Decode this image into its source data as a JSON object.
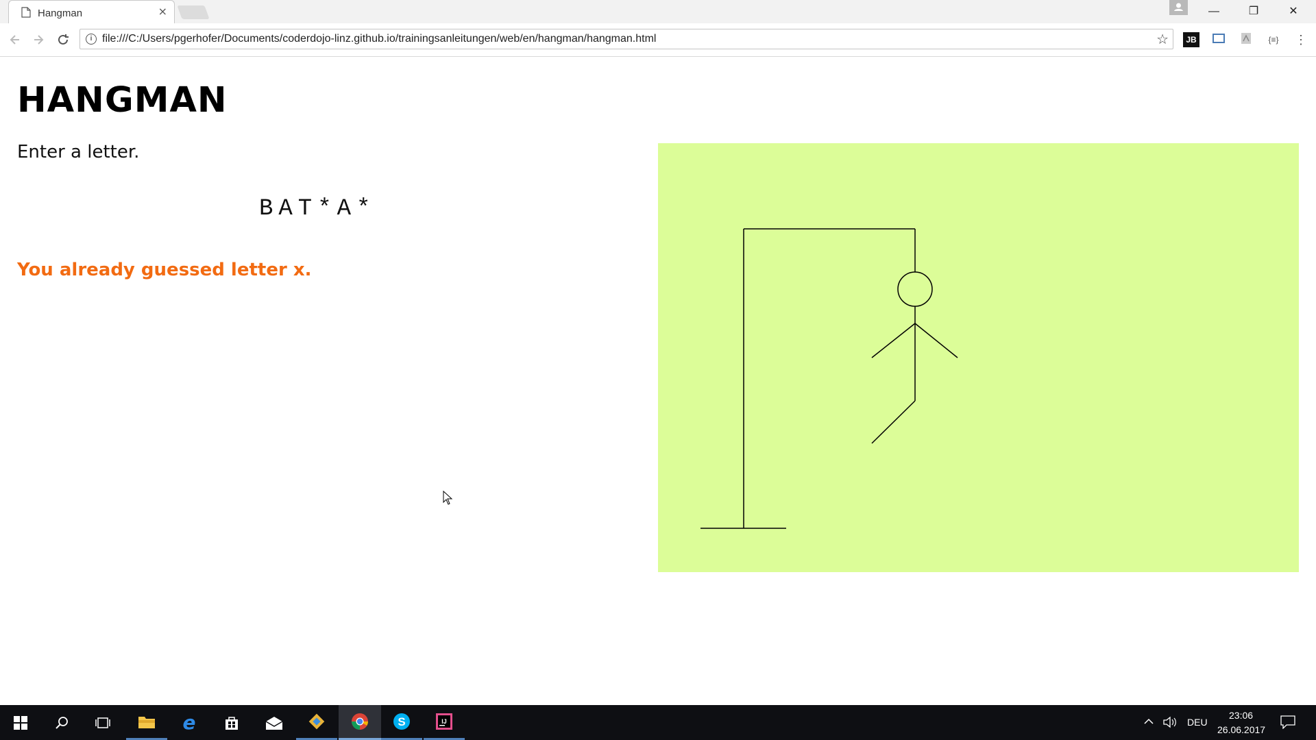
{
  "browser": {
    "tab_title": "Hangman",
    "tab_close": "×",
    "url": "file:///C:/Users/pgerhofer/Documents/coderdojo-linz.github.io/trainingsanleitungen/web/en/hangman/hangman.html",
    "window_controls": {
      "minimize": "—",
      "restore": "❐",
      "close": "✕"
    },
    "extensions": [
      "JB",
      "screen-capture-icon",
      "pdf-icon",
      "json-icon"
    ]
  },
  "page": {
    "heading": "HANGMAN",
    "prompt": "Enter a letter.",
    "word_display": "BAT*A*",
    "message": "You already guessed letter x.",
    "colors": {
      "message": "#f26b12",
      "board_background": "#dcfd98"
    },
    "hangman_parts_visible": [
      "base",
      "pole",
      "beam",
      "rope",
      "head",
      "body",
      "left-arm",
      "right-arm",
      "left-leg"
    ]
  },
  "taskbar": {
    "apps": [
      "start-icon",
      "search-icon",
      "task-view-icon",
      "file-explorer-icon",
      "edge-icon",
      "store-icon",
      "mail-icon",
      "git-icon",
      "chrome-icon",
      "skype-icon",
      "intellij-icon"
    ],
    "language": "DEU",
    "time": "23:06",
    "date": "26.06.2017"
  }
}
